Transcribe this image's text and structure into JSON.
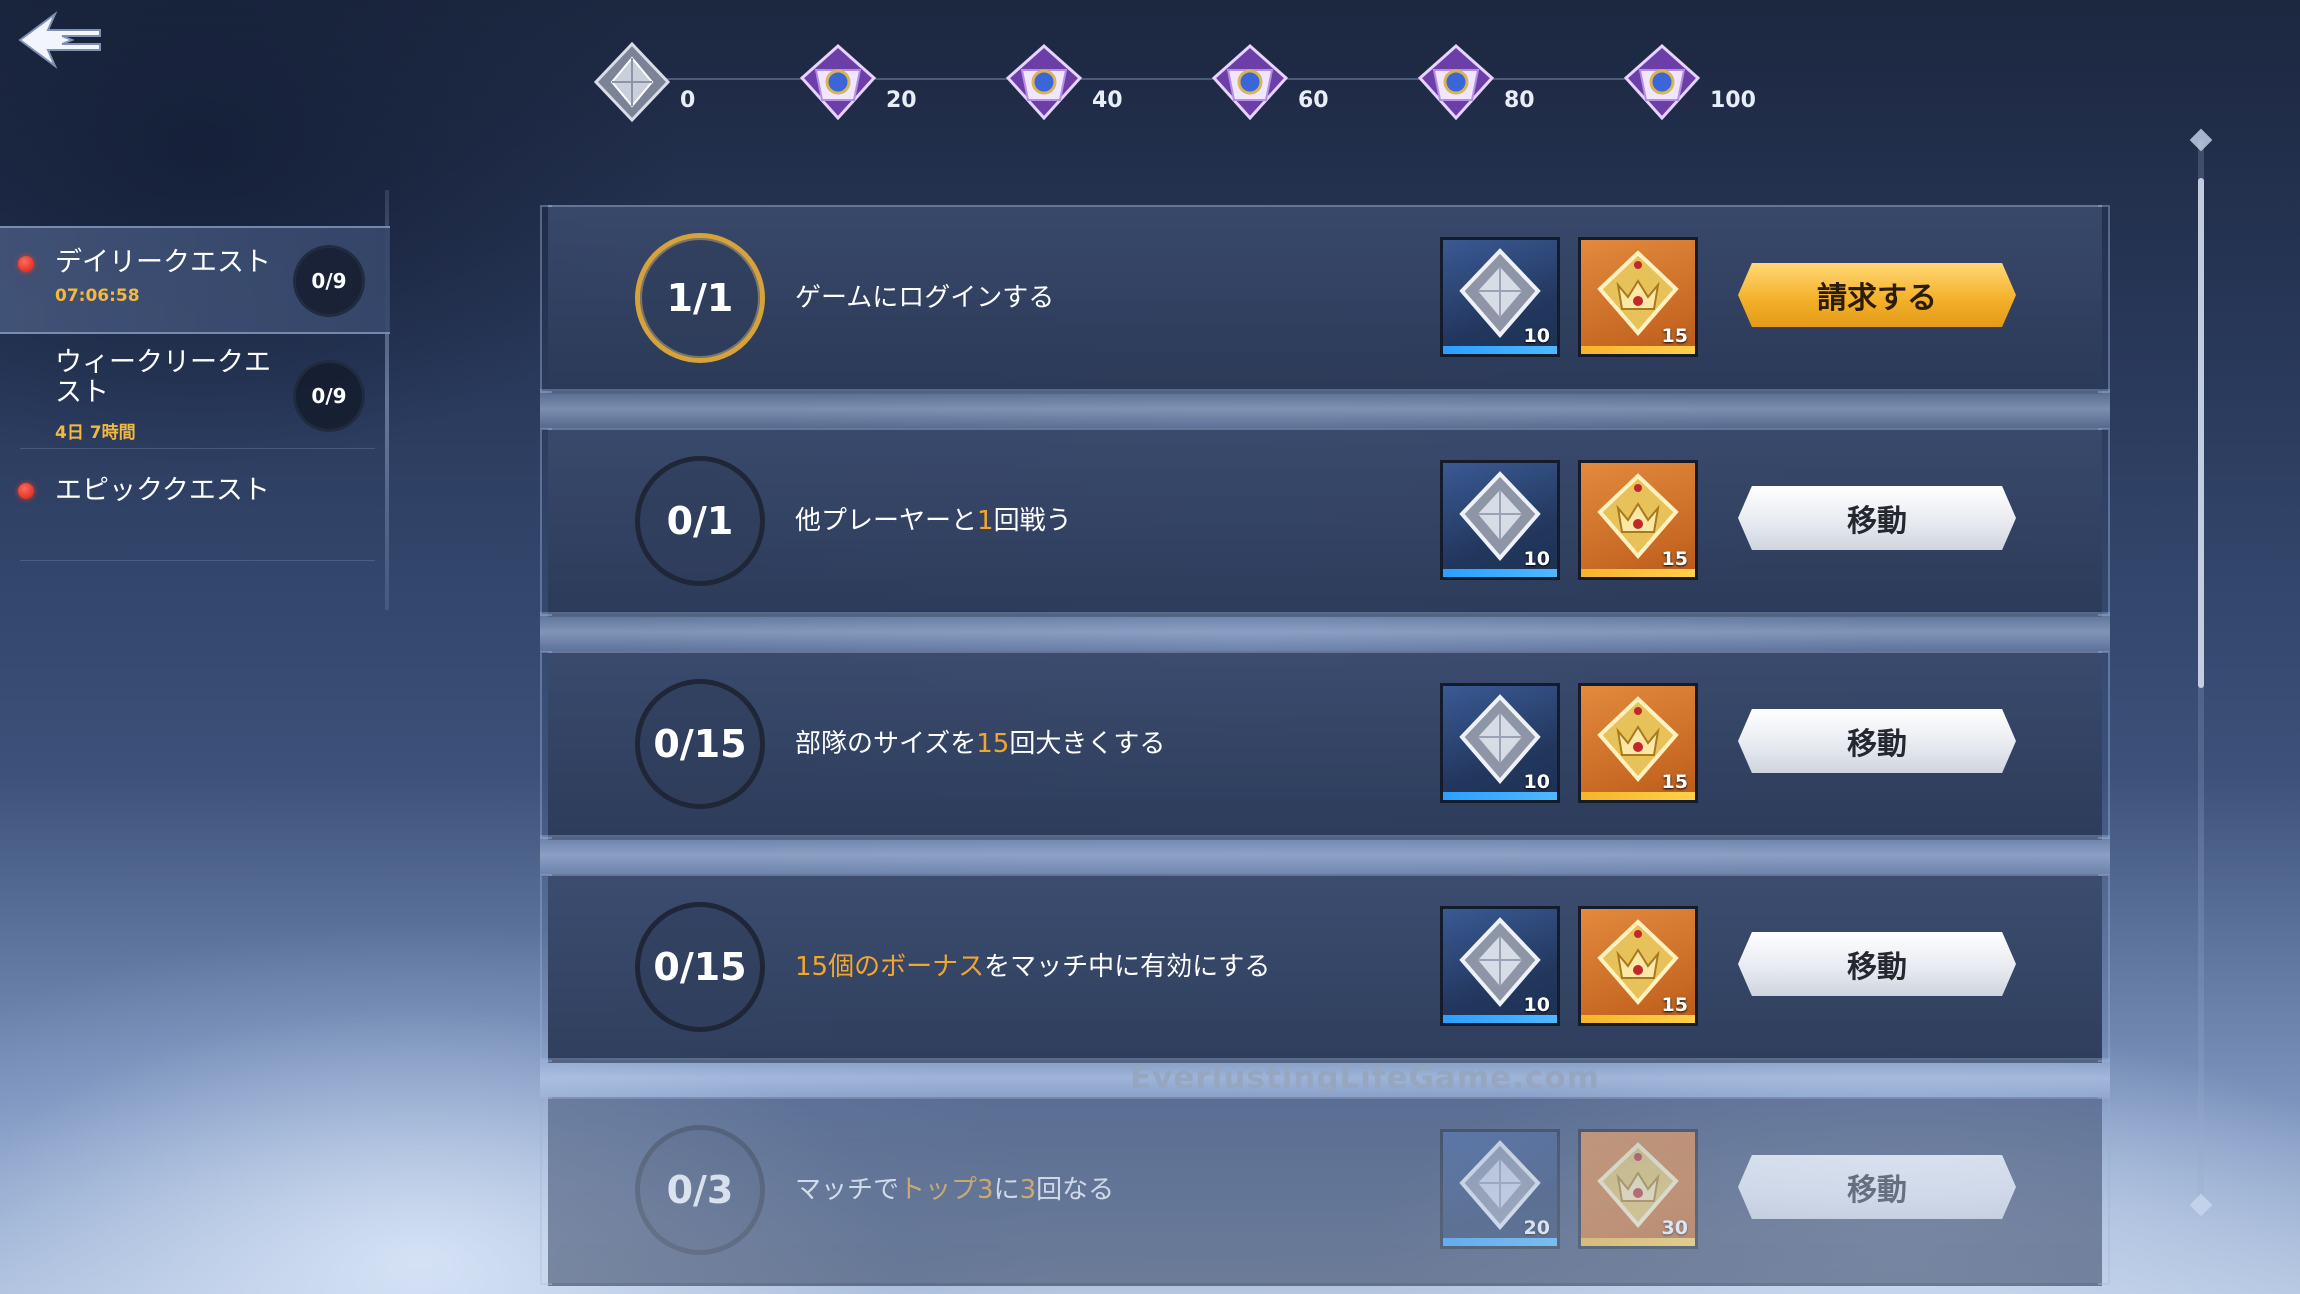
{
  "header": {
    "back_icon": "back-arrow-icon"
  },
  "progress": {
    "milestones": [
      {
        "label": "0",
        "icon": "silver-crystal-icon"
      },
      {
        "label": "20",
        "icon": "purple-chest-icon"
      },
      {
        "label": "40",
        "icon": "purple-chest-icon"
      },
      {
        "label": "60",
        "icon": "purple-chest-icon"
      },
      {
        "label": "80",
        "icon": "purple-chest-icon"
      },
      {
        "label": "100",
        "icon": "purple-chest-icon"
      }
    ]
  },
  "sidebar": {
    "items": [
      {
        "name": "デイリークエスト",
        "timer": "07:06:58",
        "count": "0/9",
        "has_alert": true,
        "active": true
      },
      {
        "name": "ウィークリークエスト",
        "timer": "4日 7時間",
        "count": "0/9",
        "has_alert": false,
        "active": false
      },
      {
        "name": "エピッククエスト",
        "timer": "",
        "count": "",
        "has_alert": true,
        "active": false
      }
    ]
  },
  "quests": [
    {
      "progress": "1/1",
      "text_parts": [
        {
          "t": "ゲームにログインする",
          "hl": false
        }
      ],
      "rewards": [
        {
          "icon": "silver-crystal-icon",
          "qty": "10"
        },
        {
          "icon": "gold-emblem-icon",
          "qty": "15"
        }
      ],
      "button": "請求する",
      "button_type": "claim"
    },
    {
      "progress": "0/1",
      "text_parts": [
        {
          "t": "他プレーヤーと",
          "hl": false
        },
        {
          "t": "1",
          "hl": true
        },
        {
          "t": "回戦う",
          "hl": false
        }
      ],
      "rewards": [
        {
          "icon": "silver-crystal-icon",
          "qty": "10"
        },
        {
          "icon": "gold-emblem-icon",
          "qty": "15"
        }
      ],
      "button": "移動",
      "button_type": "move"
    },
    {
      "progress": "0/15",
      "text_parts": [
        {
          "t": "部隊のサイズを",
          "hl": false
        },
        {
          "t": "15",
          "hl": true
        },
        {
          "t": "回大きくする",
          "hl": false
        }
      ],
      "rewards": [
        {
          "icon": "silver-crystal-icon",
          "qty": "10"
        },
        {
          "icon": "gold-emblem-icon",
          "qty": "15"
        }
      ],
      "button": "移動",
      "button_type": "move"
    },
    {
      "progress": "0/15",
      "text_parts": [
        {
          "t": "15個のボーナス",
          "hl": true
        },
        {
          "t": "をマッチ中に有効にする",
          "hl": false
        }
      ],
      "rewards": [
        {
          "icon": "silver-crystal-icon",
          "qty": "10"
        },
        {
          "icon": "gold-emblem-icon",
          "qty": "15"
        }
      ],
      "button": "移動",
      "button_type": "move"
    },
    {
      "progress": "0/3",
      "text_parts": [
        {
          "t": "マッチで",
          "hl": false
        },
        {
          "t": "トップ3",
          "hl": true
        },
        {
          "t": "に",
          "hl": false
        },
        {
          "t": "3",
          "hl": true
        },
        {
          "t": "回なる",
          "hl": false
        }
      ],
      "rewards": [
        {
          "icon": "silver-crystal-icon",
          "qty": "20"
        },
        {
          "icon": "gold-emblem-icon",
          "qty": "30"
        }
      ],
      "button": "移動",
      "button_type": "move"
    }
  ],
  "watermark": "EverlustingLifeGame.com",
  "colors": {
    "accent_gold": "#f3a62a",
    "claim_button": "#f5b22c",
    "alert_red": "#d41e14",
    "timer_gold": "#f3b93c"
  }
}
